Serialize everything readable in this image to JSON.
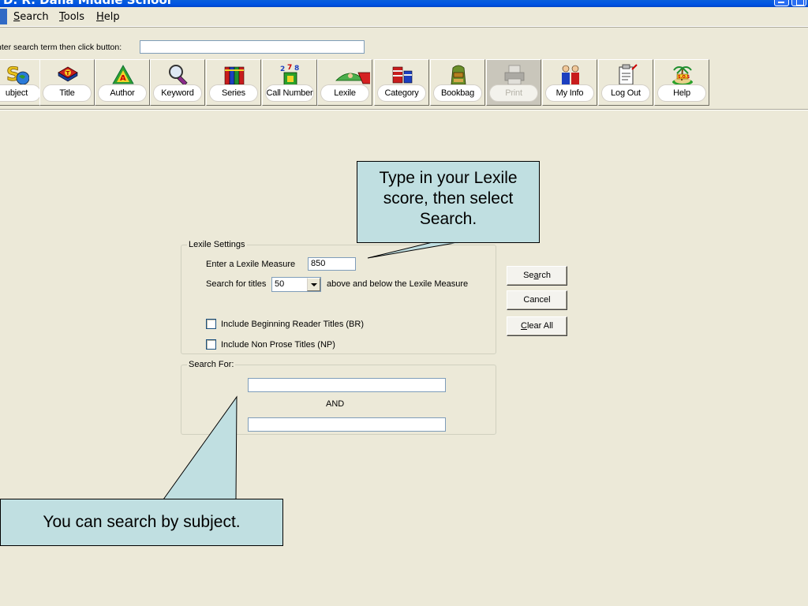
{
  "window": {
    "title": "D. R. Dana Middle School",
    "controls": [
      "minimize",
      "restore"
    ]
  },
  "menubar": {
    "items": [
      {
        "label": "Search",
        "mnemonic": "S",
        "rest": "earch"
      },
      {
        "label": "Tools",
        "mnemonic": "T",
        "rest": "ools"
      },
      {
        "label": "Help",
        "mnemonic": "H",
        "rest": "elp"
      }
    ]
  },
  "search_row": {
    "label": "nter search term then click button:",
    "input_value": ""
  },
  "toolbar": {
    "buttons": [
      {
        "label": "ubject",
        "icon": "subject-icon"
      },
      {
        "label": "Title",
        "icon": "title-icon"
      },
      {
        "label": "Author",
        "icon": "author-icon"
      },
      {
        "label": "Keyword",
        "icon": "keyword-icon"
      },
      {
        "label": "Series",
        "icon": "series-icon"
      },
      {
        "label": "Call Number",
        "icon": "call-number-icon"
      },
      {
        "label": "Lexile",
        "icon": "lexile-icon"
      },
      {
        "label": "Category",
        "icon": "category-icon"
      },
      {
        "label": "Bookbag",
        "icon": "bookbag-icon"
      },
      {
        "label": "Print",
        "icon": "print-icon",
        "disabled": true
      },
      {
        "label": "My Info",
        "icon": "my-info-icon"
      },
      {
        "label": "Log Out",
        "icon": "log-out-icon"
      },
      {
        "label": "Help",
        "icon": "help-icon"
      }
    ]
  },
  "lexile_settings": {
    "legend": "Lexile Settings",
    "measure_label": "Enter a Lexile Measure",
    "measure_value": "850",
    "search_titles_label": "Search for titles",
    "range_value": "50",
    "range_suffix": "above and below the Lexile Measure",
    "include_br_label": "Include Beginning Reader Titles (BR)",
    "include_br_checked": false,
    "include_np_label": "Include Non Prose Titles (NP)",
    "include_np_checked": false
  },
  "search_for": {
    "legend": "Search For:",
    "term1_value": "",
    "connector": "AND",
    "term2_value": ""
  },
  "actions": {
    "search": {
      "pre": "Se",
      "mnemonic": "a",
      "post": "rch"
    },
    "cancel": "Cancel",
    "clear_all": {
      "pre": "",
      "mnemonic": "C",
      "post": "lear All"
    }
  },
  "callouts": {
    "lexile": "Type in your Lexile score, then select Search.",
    "subject": "You can search by subject."
  },
  "colors": {
    "callout_fill": "#c0dfe1",
    "window_bg": "#ece9d8",
    "titlebar": "#0054e3"
  }
}
